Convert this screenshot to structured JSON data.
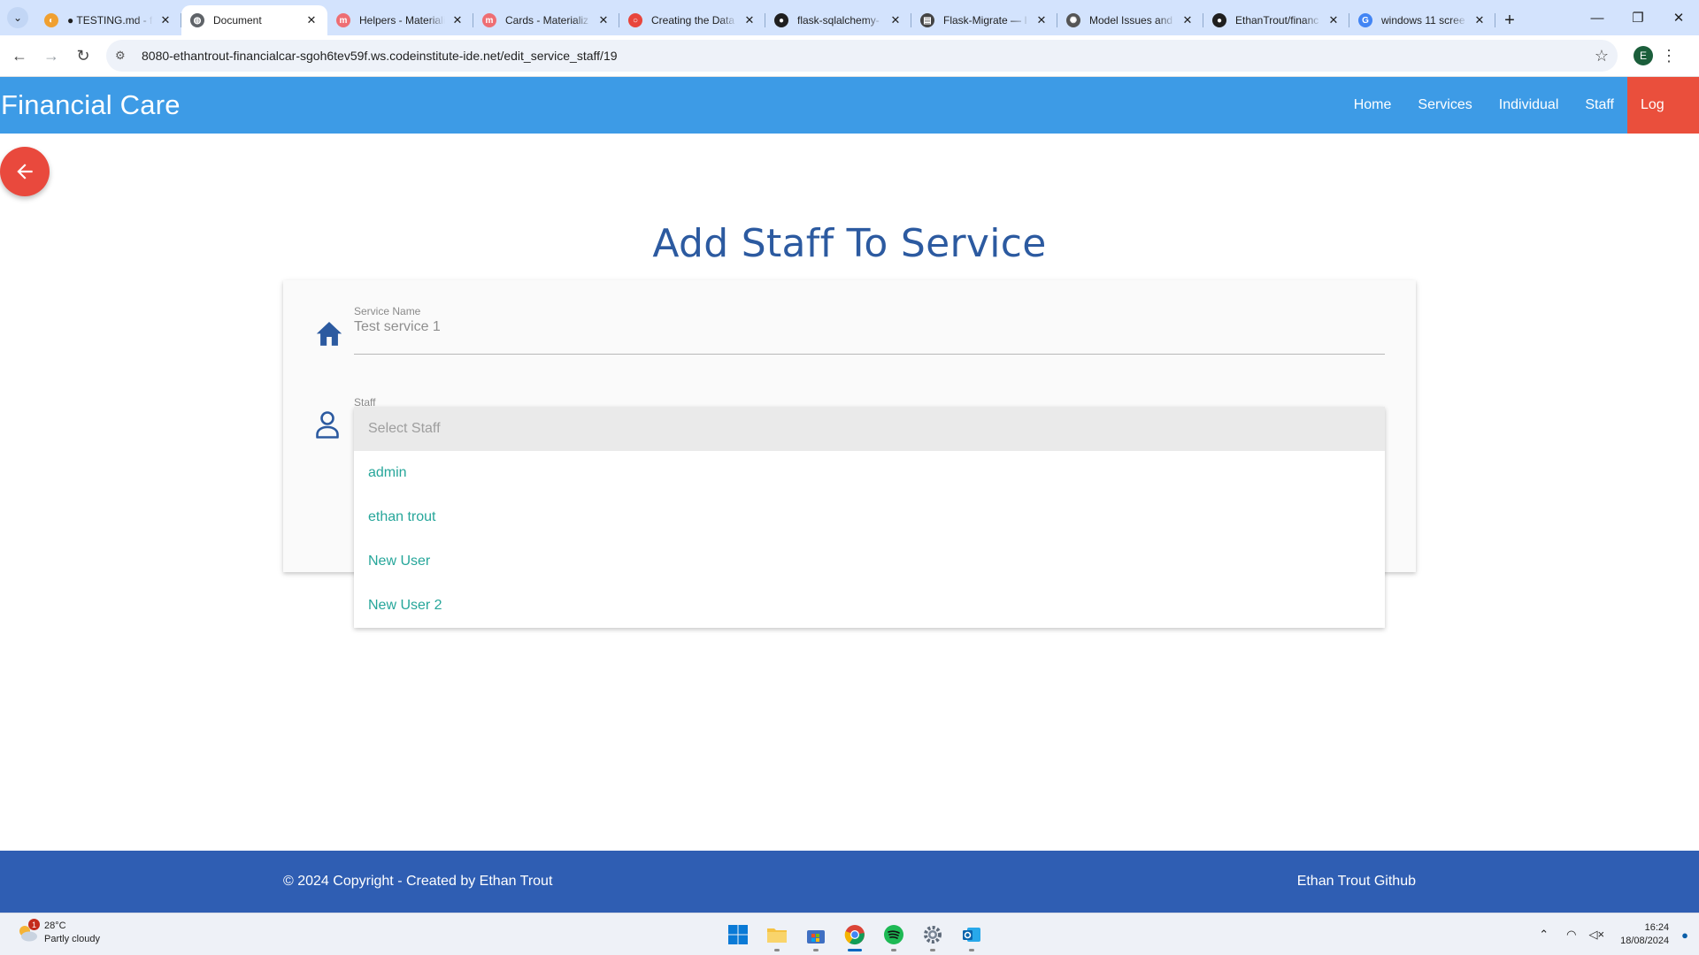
{
  "browser": {
    "tabs": [
      {
        "title": "● TESTING.md - fi",
        "fav_color": "#f0a030",
        "fav_glyph": "◐"
      },
      {
        "title": "Document",
        "fav_color": "#5f6368",
        "fav_glyph": "◍"
      },
      {
        "title": "Helpers - Materiali",
        "fav_color": "#ee6e73",
        "fav_glyph": "m"
      },
      {
        "title": "Cards - Materializ",
        "fav_color": "#ee6e73",
        "fav_glyph": "m"
      },
      {
        "title": "Creating the Data",
        "fav_color": "#e8453c",
        "fav_glyph": "○"
      },
      {
        "title": "flask-sqlalchemy-",
        "fav_color": "#1f1f1f",
        "fav_glyph": "●"
      },
      {
        "title": "Flask-Migrate — I",
        "fav_color": "#444444",
        "fav_glyph": "▤"
      },
      {
        "title": "Model Issues and",
        "fav_color": "#555555",
        "fav_glyph": "✺"
      },
      {
        "title": "EthanTrout/financ",
        "fav_color": "#1f1f1f",
        "fav_glyph": "●"
      },
      {
        "title": "windows 11 scree",
        "fav_color": "#4285f4",
        "fav_glyph": "G"
      }
    ],
    "active_tab_index": 1,
    "url": "8080-ethantrout-financialcar-sgoh6tev59f.ws.codeinstitute-ide.net/edit_service_staff/19",
    "profile_initial": "E"
  },
  "site": {
    "brand": "Financial Care",
    "nav": [
      "Home",
      "Services",
      "Individual",
      "Staff"
    ],
    "logout_label": "Log out",
    "nav_color": "#3d9be6",
    "logout_color": "#ea4f3c"
  },
  "page": {
    "title": "Add Staff To Service"
  },
  "form": {
    "service_name_label": "Service Name",
    "service_name_value": "Test service 1",
    "staff_label": "Staff",
    "staff_select_placeholder": "Select Staff",
    "staff_options": [
      "admin",
      "ethan trout",
      "New User",
      "New User 2"
    ],
    "accent_color": "#26a69a"
  },
  "footer": {
    "copyright": "© 2024 Copyright - Created by Ethan Trout",
    "github_link": "Ethan Trout Github"
  },
  "taskbar": {
    "weather_temp": "28°C",
    "weather_desc": "Partly cloudy",
    "weather_badge": "1",
    "time": "16:24",
    "date": "18/08/2024",
    "apps": [
      "start",
      "file-explorer",
      "microsoft-store",
      "chrome",
      "spotify",
      "settings",
      "outlook"
    ]
  }
}
